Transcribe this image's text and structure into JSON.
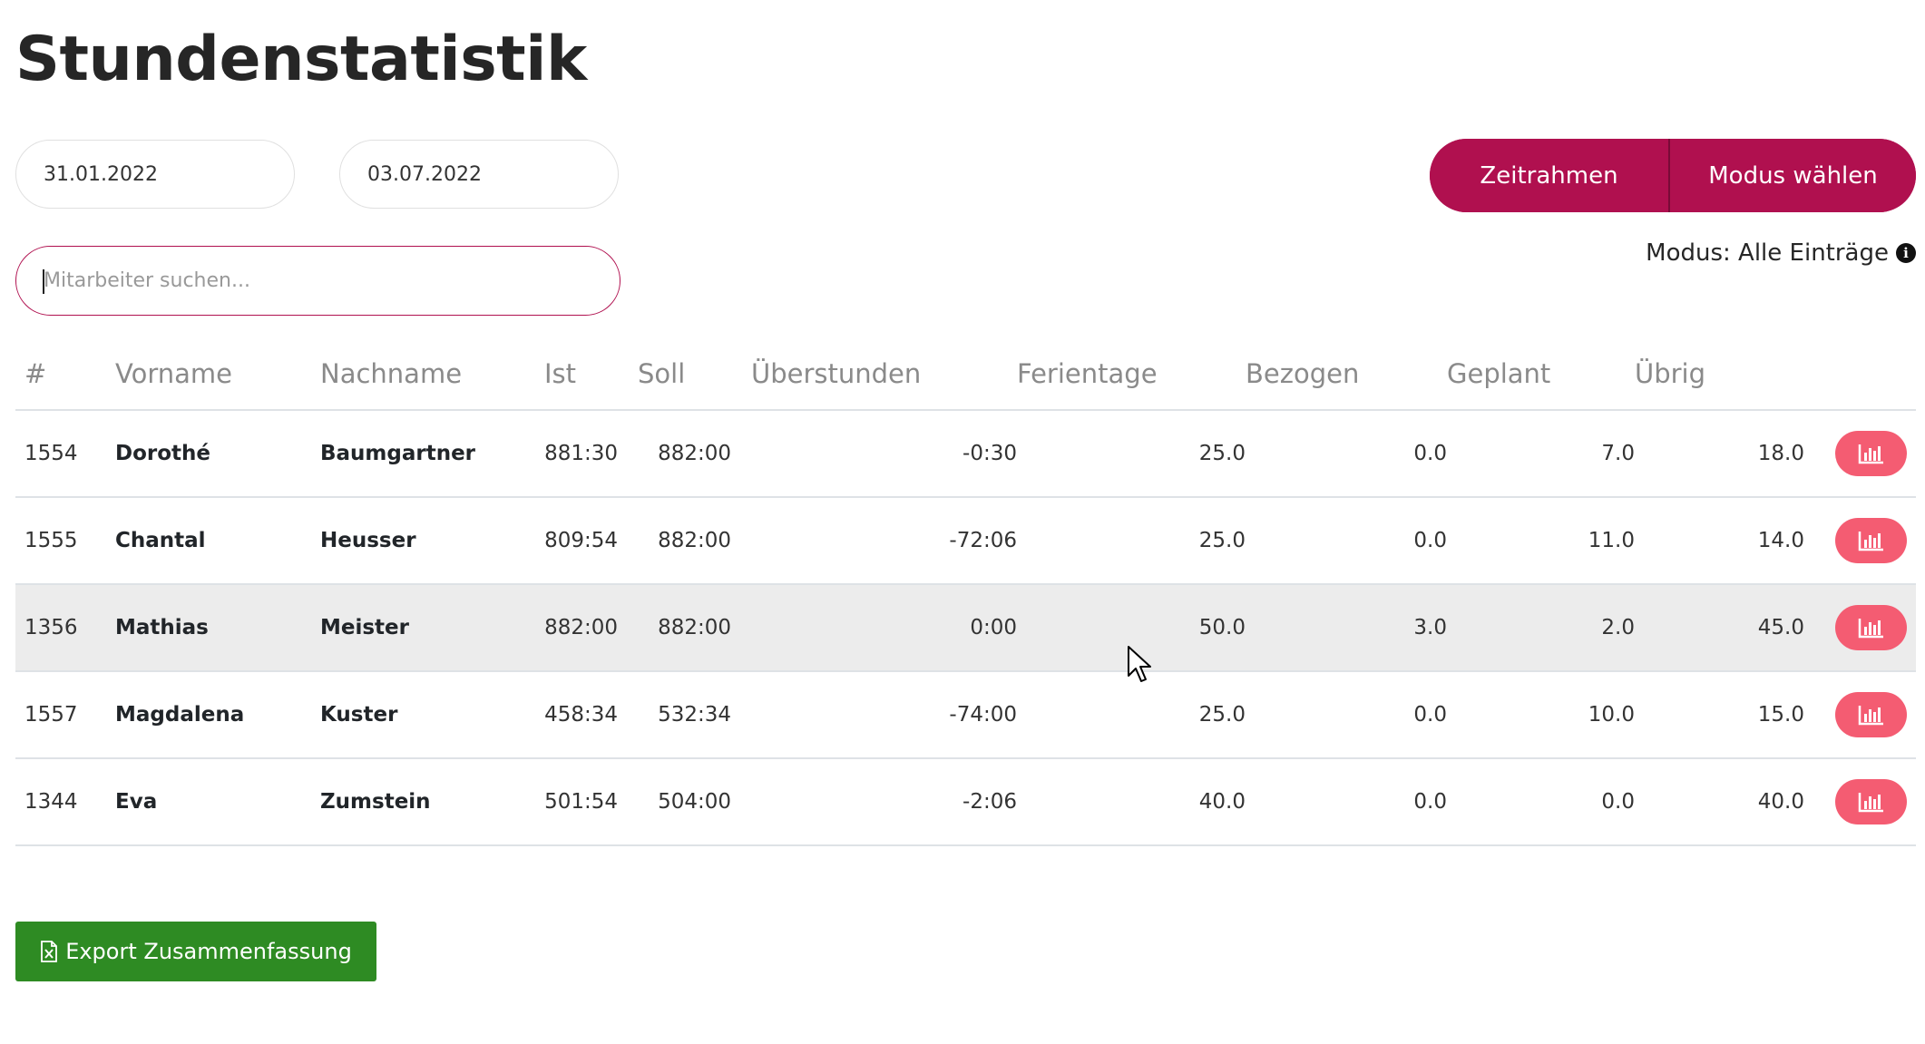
{
  "page": {
    "title": "Stundenstatistik"
  },
  "filters": {
    "date_from": "31.01.2022",
    "date_to": "03.07.2022",
    "search_placeholder": "Mitarbeiter suchen..."
  },
  "actions": {
    "zeitrahmen_label": "Zeitrahmen",
    "modus_label": "Modus wählen",
    "mode_text": "Modus: Alle Einträge",
    "export_label": "Export Zusammenfassung"
  },
  "table": {
    "headers": [
      "#",
      "Vorname",
      "Nachname",
      "Ist",
      "Soll",
      "Überstunden",
      "Ferientage",
      "Bezogen",
      "Geplant",
      "Übrig"
    ],
    "rows": [
      {
        "id": "1554",
        "first": "Dorothé",
        "last": "Baumgartner",
        "ist": "881:30",
        "soll": "882:00",
        "ueber": "-0:30",
        "ferien": "25.0",
        "bezogen": "0.0",
        "geplant": "7.0",
        "uebrig": "18.0"
      },
      {
        "id": "1555",
        "first": "Chantal",
        "last": "Heusser",
        "ist": "809:54",
        "soll": "882:00",
        "ueber": "-72:06",
        "ferien": "25.0",
        "bezogen": "0.0",
        "geplant": "11.0",
        "uebrig": "14.0"
      },
      {
        "id": "1356",
        "first": "Mathias",
        "last": "Meister",
        "ist": "882:00",
        "soll": "882:00",
        "ueber": "0:00",
        "ferien": "50.0",
        "bezogen": "3.0",
        "geplant": "2.0",
        "uebrig": "45.0"
      },
      {
        "id": "1557",
        "first": "Magdalena",
        "last": "Kuster",
        "ist": "458:34",
        "soll": "532:34",
        "ueber": "-74:00",
        "ferien": "25.0",
        "bezogen": "0.0",
        "geplant": "10.0",
        "uebrig": "15.0"
      },
      {
        "id": "1344",
        "first": "Eva",
        "last": "Zumstein",
        "ist": "501:54",
        "soll": "504:00",
        "ueber": "-2:06",
        "ferien": "40.0",
        "bezogen": "0.0",
        "geplant": "0.0",
        "uebrig": "40.0"
      }
    ]
  },
  "colors": {
    "accent": "#b0104f",
    "stat_button": "#f45c72",
    "export": "#2e8b23",
    "row_highlight": "#ececec"
  },
  "icons": {
    "mode_info": "info-circle-icon",
    "row_action": "bar-chart-icon",
    "export": "file-excel-icon"
  }
}
